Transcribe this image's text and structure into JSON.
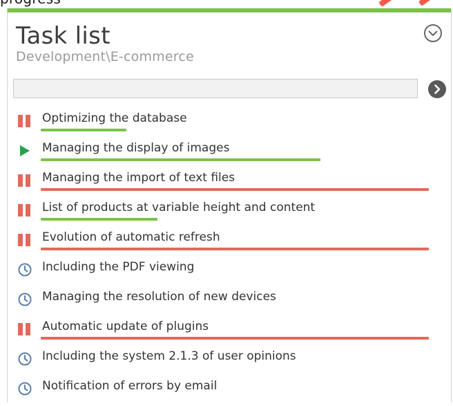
{
  "page": {
    "cut_word": "progress"
  },
  "panel": {
    "title": "Task list",
    "subtitle": "Development\\E-commerce",
    "collapse_icon": "chevron-down-circle-icon",
    "search": {
      "value": "",
      "placeholder": ""
    },
    "go_icon": "chevron-right-circle-icon"
  },
  "colors": {
    "accent_green": "#7cc04d",
    "accent_red": "#e06a5c",
    "clock_blue": "#5b7fa8",
    "text": "#333333"
  },
  "tasks": [
    {
      "label": "Optimizing the database",
      "status": "paused",
      "status_icon": "pause-icon",
      "progress": 0.22,
      "progress_color": "green"
    },
    {
      "label": "Managing the display of images",
      "status": "running",
      "status_icon": "play-icon",
      "progress": 0.72,
      "progress_color": "green"
    },
    {
      "label": "Managing the import of text files",
      "status": "paused",
      "status_icon": "pause-icon",
      "progress": 1.0,
      "progress_color": "red"
    },
    {
      "label": "List of products at variable height and content",
      "status": "paused",
      "status_icon": "pause-icon",
      "progress": 0.3,
      "progress_color": "green"
    },
    {
      "label": "Evolution of automatic refresh",
      "status": "paused",
      "status_icon": "pause-icon",
      "progress": 1.0,
      "progress_color": "red"
    },
    {
      "label": "Including the PDF viewing",
      "status": "scheduled",
      "status_icon": "clock-icon",
      "progress": null,
      "progress_color": null
    },
    {
      "label": "Managing the resolution of new devices",
      "status": "scheduled",
      "status_icon": "clock-icon",
      "progress": null,
      "progress_color": null
    },
    {
      "label": "Automatic update of plugins",
      "status": "paused",
      "status_icon": "pause-icon",
      "progress": 1.0,
      "progress_color": "red"
    },
    {
      "label": "Including the system 2.1.3 of user opinions",
      "status": "scheduled",
      "status_icon": "clock-icon",
      "progress": null,
      "progress_color": null
    },
    {
      "label": "Notification of errors by email",
      "status": "scheduled",
      "status_icon": "clock-icon",
      "progress": null,
      "progress_color": null
    }
  ]
}
